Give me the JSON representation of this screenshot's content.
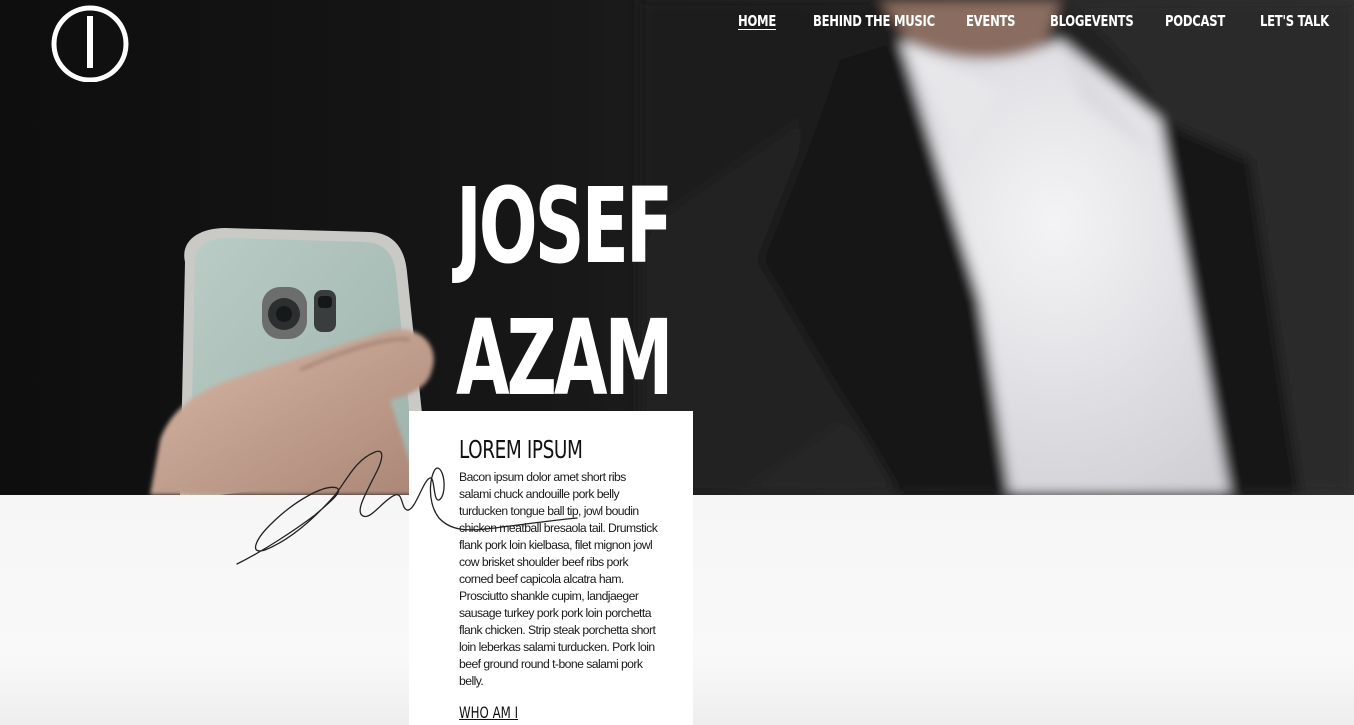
{
  "nav": {
    "items": [
      {
        "label": "HOME",
        "active": true
      },
      {
        "label": "BEHIND THE MUSIC",
        "active": false
      },
      {
        "label": "EVENTS",
        "active": false
      },
      {
        "label": "BLOGEVENTS",
        "active": false
      },
      {
        "label": "PODCAST",
        "active": false
      },
      {
        "label": "LET'S TALK",
        "active": false
      }
    ]
  },
  "hero": {
    "title_line1": "JOSEF",
    "title_line2": "AZAM"
  },
  "card": {
    "heading": "LOREM IPSUM",
    "body": "Bacon ipsum dolor amet short ribs salami chuck andouille pork belly turducken tongue ball tip, jowl boudin chicken meatball bresaola tail. Drumstick flank pork loin kielbasa, filet mignon jowl cow brisket shoulder beef ribs pork corned beef capicola alcatra ham. Prosciutto shankle cupim, landjaeger sausage turkey pork pork loin porchetta flank chicken. Strip steak porchetta short loin leberkas salami turducken. Pork loin beef ground round t-bone salami pork belly.",
    "link": "WHO AM I"
  },
  "colors": {
    "hero_bg": "#141414",
    "text_light": "#ffffff",
    "card_bg": "#ffffff",
    "page_bg": "#f7f7f7"
  }
}
